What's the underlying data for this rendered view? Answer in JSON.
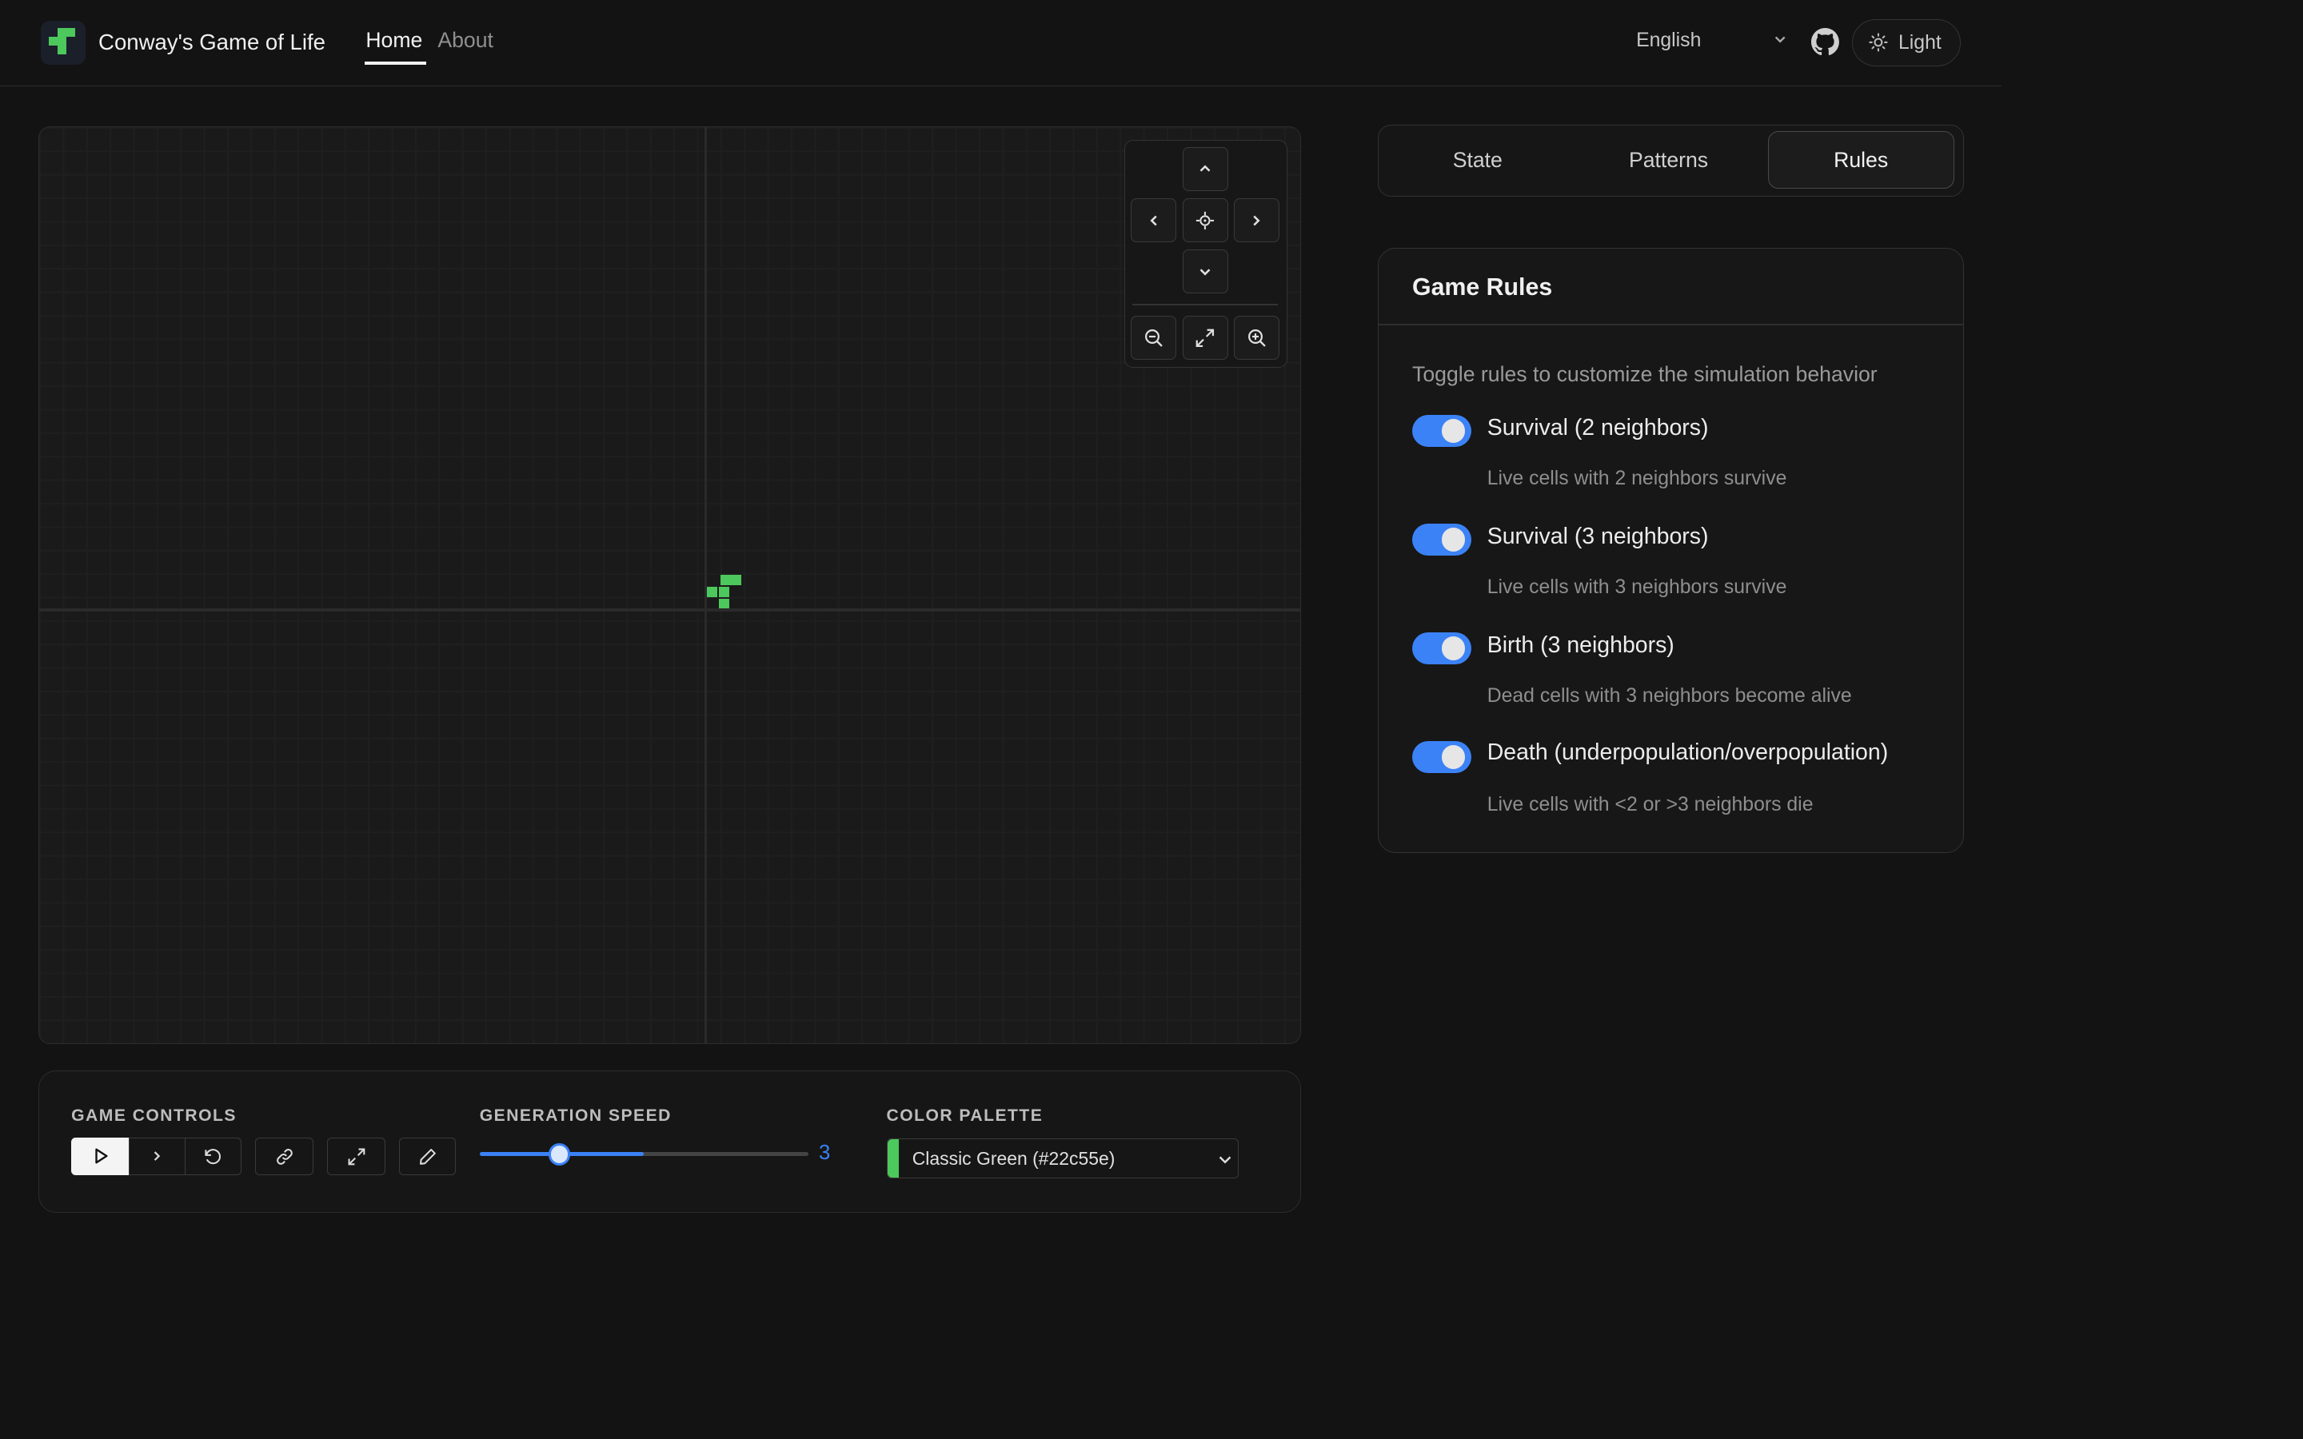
{
  "header": {
    "title": "Conway's Game of Life",
    "nav": [
      {
        "label": "Home",
        "active": true
      },
      {
        "label": "About",
        "active": false
      }
    ],
    "language": "English",
    "theme_label": "Light"
  },
  "board": {
    "cell_color": "#4cc85c"
  },
  "controls": {
    "game_controls_label": "GAME CONTROLS",
    "speed_label": "GENERATION SPEED",
    "speed_value": "3",
    "speed_fill_fraction": 0.5,
    "speed_thumb_fraction": 0.24,
    "palette_label": "COLOR PALETTE",
    "palette_selected": "Classic Green (#22c55e)",
    "palette_color": "#4cc85c"
  },
  "tabs": [
    {
      "label": "State",
      "active": false
    },
    {
      "label": "Patterns",
      "active": false
    },
    {
      "label": "Rules",
      "active": true
    }
  ],
  "rules": {
    "title": "Game Rules",
    "description": "Toggle rules to customize the simulation behavior",
    "items": [
      {
        "name": "Survival (2 neighbors)",
        "desc": "Live cells with 2 neighbors survive",
        "enabled": true
      },
      {
        "name": "Survival (3 neighbors)",
        "desc": "Live cells with 3 neighbors survive",
        "enabled": true
      },
      {
        "name": "Birth (3 neighbors)",
        "desc": "Dead cells with 3 neighbors become alive",
        "enabled": true
      },
      {
        "name": "Death (underpopulation/overpopulation)",
        "desc": "Live cells with <2 or >3 neighbors die",
        "enabled": true
      }
    ]
  },
  "colors": {
    "accent": "#3b82f6",
    "background": "#131313"
  }
}
